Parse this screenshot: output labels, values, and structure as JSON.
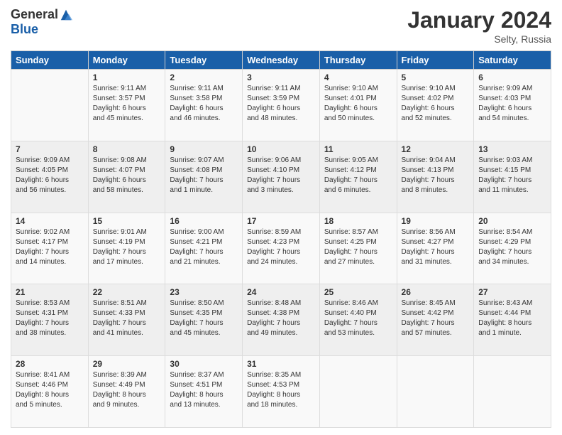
{
  "header": {
    "logo_general": "General",
    "logo_blue": "Blue",
    "month_title": "January 2024",
    "location": "Selty, Russia"
  },
  "days_of_week": [
    "Sunday",
    "Monday",
    "Tuesday",
    "Wednesday",
    "Thursday",
    "Friday",
    "Saturday"
  ],
  "weeks": [
    [
      {
        "day": "",
        "info": ""
      },
      {
        "day": "1",
        "info": "Sunrise: 9:11 AM\nSunset: 3:57 PM\nDaylight: 6 hours\nand 45 minutes."
      },
      {
        "day": "2",
        "info": "Sunrise: 9:11 AM\nSunset: 3:58 PM\nDaylight: 6 hours\nand 46 minutes."
      },
      {
        "day": "3",
        "info": "Sunrise: 9:11 AM\nSunset: 3:59 PM\nDaylight: 6 hours\nand 48 minutes."
      },
      {
        "day": "4",
        "info": "Sunrise: 9:10 AM\nSunset: 4:01 PM\nDaylight: 6 hours\nand 50 minutes."
      },
      {
        "day": "5",
        "info": "Sunrise: 9:10 AM\nSunset: 4:02 PM\nDaylight: 6 hours\nand 52 minutes."
      },
      {
        "day": "6",
        "info": "Sunrise: 9:09 AM\nSunset: 4:03 PM\nDaylight: 6 hours\nand 54 minutes."
      }
    ],
    [
      {
        "day": "7",
        "info": "Sunrise: 9:09 AM\nSunset: 4:05 PM\nDaylight: 6 hours\nand 56 minutes."
      },
      {
        "day": "8",
        "info": "Sunrise: 9:08 AM\nSunset: 4:07 PM\nDaylight: 6 hours\nand 58 minutes."
      },
      {
        "day": "9",
        "info": "Sunrise: 9:07 AM\nSunset: 4:08 PM\nDaylight: 7 hours\nand 1 minute."
      },
      {
        "day": "10",
        "info": "Sunrise: 9:06 AM\nSunset: 4:10 PM\nDaylight: 7 hours\nand 3 minutes."
      },
      {
        "day": "11",
        "info": "Sunrise: 9:05 AM\nSunset: 4:12 PM\nDaylight: 7 hours\nand 6 minutes."
      },
      {
        "day": "12",
        "info": "Sunrise: 9:04 AM\nSunset: 4:13 PM\nDaylight: 7 hours\nand 8 minutes."
      },
      {
        "day": "13",
        "info": "Sunrise: 9:03 AM\nSunset: 4:15 PM\nDaylight: 7 hours\nand 11 minutes."
      }
    ],
    [
      {
        "day": "14",
        "info": "Sunrise: 9:02 AM\nSunset: 4:17 PM\nDaylight: 7 hours\nand 14 minutes."
      },
      {
        "day": "15",
        "info": "Sunrise: 9:01 AM\nSunset: 4:19 PM\nDaylight: 7 hours\nand 17 minutes."
      },
      {
        "day": "16",
        "info": "Sunrise: 9:00 AM\nSunset: 4:21 PM\nDaylight: 7 hours\nand 21 minutes."
      },
      {
        "day": "17",
        "info": "Sunrise: 8:59 AM\nSunset: 4:23 PM\nDaylight: 7 hours\nand 24 minutes."
      },
      {
        "day": "18",
        "info": "Sunrise: 8:57 AM\nSunset: 4:25 PM\nDaylight: 7 hours\nand 27 minutes."
      },
      {
        "day": "19",
        "info": "Sunrise: 8:56 AM\nSunset: 4:27 PM\nDaylight: 7 hours\nand 31 minutes."
      },
      {
        "day": "20",
        "info": "Sunrise: 8:54 AM\nSunset: 4:29 PM\nDaylight: 7 hours\nand 34 minutes."
      }
    ],
    [
      {
        "day": "21",
        "info": "Sunrise: 8:53 AM\nSunset: 4:31 PM\nDaylight: 7 hours\nand 38 minutes."
      },
      {
        "day": "22",
        "info": "Sunrise: 8:51 AM\nSunset: 4:33 PM\nDaylight: 7 hours\nand 41 minutes."
      },
      {
        "day": "23",
        "info": "Sunrise: 8:50 AM\nSunset: 4:35 PM\nDaylight: 7 hours\nand 45 minutes."
      },
      {
        "day": "24",
        "info": "Sunrise: 8:48 AM\nSunset: 4:38 PM\nDaylight: 7 hours\nand 49 minutes."
      },
      {
        "day": "25",
        "info": "Sunrise: 8:46 AM\nSunset: 4:40 PM\nDaylight: 7 hours\nand 53 minutes."
      },
      {
        "day": "26",
        "info": "Sunrise: 8:45 AM\nSunset: 4:42 PM\nDaylight: 7 hours\nand 57 minutes."
      },
      {
        "day": "27",
        "info": "Sunrise: 8:43 AM\nSunset: 4:44 PM\nDaylight: 8 hours\nand 1 minute."
      }
    ],
    [
      {
        "day": "28",
        "info": "Sunrise: 8:41 AM\nSunset: 4:46 PM\nDaylight: 8 hours\nand 5 minutes."
      },
      {
        "day": "29",
        "info": "Sunrise: 8:39 AM\nSunset: 4:49 PM\nDaylight: 8 hours\nand 9 minutes."
      },
      {
        "day": "30",
        "info": "Sunrise: 8:37 AM\nSunset: 4:51 PM\nDaylight: 8 hours\nand 13 minutes."
      },
      {
        "day": "31",
        "info": "Sunrise: 8:35 AM\nSunset: 4:53 PM\nDaylight: 8 hours\nand 18 minutes."
      },
      {
        "day": "",
        "info": ""
      },
      {
        "day": "",
        "info": ""
      },
      {
        "day": "",
        "info": ""
      }
    ]
  ]
}
